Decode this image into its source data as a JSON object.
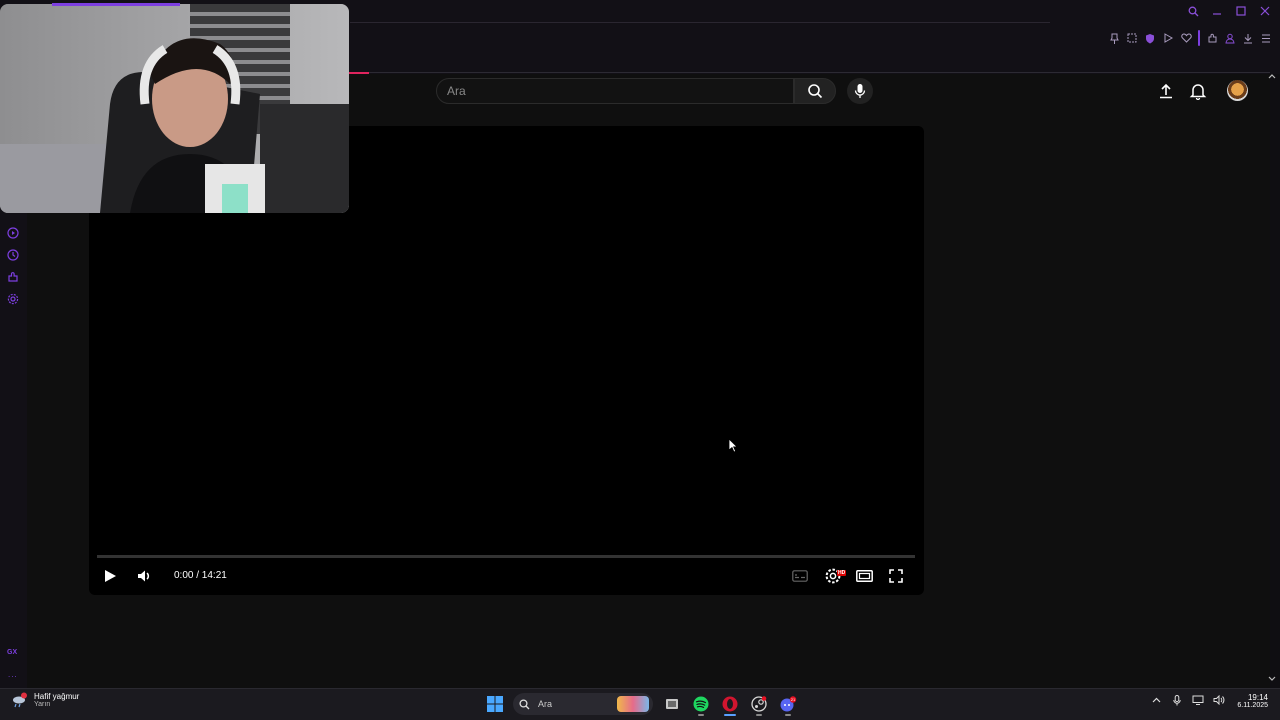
{
  "browser": {
    "window_controls": [
      "search-icon",
      "minimize-icon",
      "maximize-icon",
      "close-icon"
    ],
    "toolbar": [
      "pin-icon",
      "snapshot-icon",
      "shield-icon",
      "play-icon",
      "heart-icon",
      "extensions-icon",
      "profile-icon",
      "download-icon",
      "menu-icon"
    ],
    "accent_color": "#7d3fe0"
  },
  "sidebar": {
    "items": [
      "player-icon",
      "history-icon",
      "extensions-icon",
      "settings-icon"
    ],
    "gx_label": "GX",
    "more_label": "..."
  },
  "youtube": {
    "search": {
      "placeholder": "Ara"
    },
    "header_icons": [
      "upload-icon",
      "bell-icon",
      "avatar"
    ]
  },
  "player": {
    "time": "0:00 / 14:21",
    "progress": 0,
    "hd_badge": "HD"
  },
  "taskbar": {
    "weather": {
      "title": "Hafif yağmur",
      "subtitle": "Yarın",
      "alert_count": "1"
    },
    "search_label": "Ara",
    "apps": [
      "windows-start-icon",
      "task-view-icon",
      "spotify-icon",
      "opera-gx-icon",
      "steam-icon",
      "discord-icon"
    ],
    "discord_badge": "21",
    "clock": {
      "time": "19:14",
      "date": "6.11.2025"
    }
  }
}
